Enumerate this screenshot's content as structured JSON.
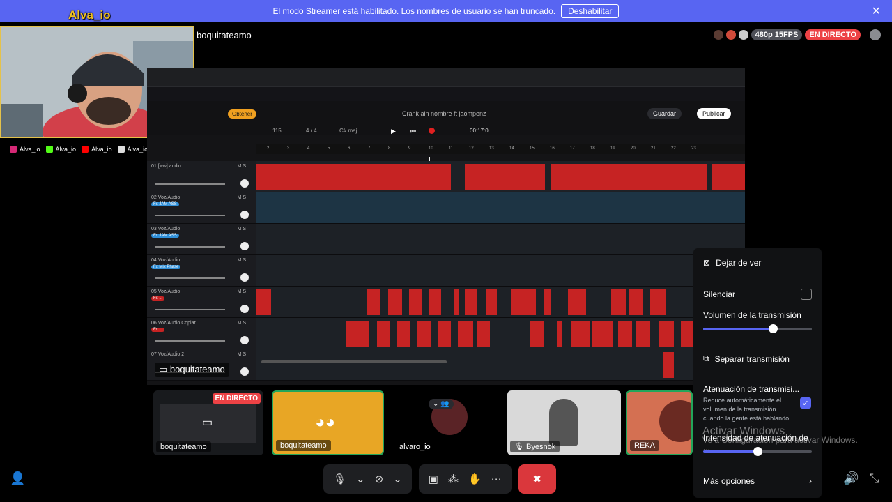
{
  "banner": {
    "message": "El modo Streamer está habilitado. Los nombres de usuario se han truncado.",
    "button": "Deshabilitar",
    "close_icon": "close-icon"
  },
  "overlay": {
    "channel_name": "Alva_io",
    "socials": [
      {
        "icon": "instagram-icon",
        "name": "Alva_io",
        "color": "#d62976"
      },
      {
        "icon": "kick-icon",
        "name": "Alva_io",
        "color": "#53fc18"
      },
      {
        "icon": "youtube-icon",
        "name": "Alva_io",
        "color": "#ff0000"
      },
      {
        "icon": "tiktok-icon",
        "name": "Alva_io",
        "color": "#111111"
      }
    ]
  },
  "stream": {
    "streamer": "boquitateamo",
    "quality": "480p 15FPS",
    "live": "EN DIRECTO",
    "label": "boquitateamo"
  },
  "daw": {
    "song_title": "Crank ain nombre ft jaompenz",
    "save": "Guardar",
    "publish": "Publicar",
    "get_button": "Obtener",
    "time": "00:17:0",
    "bpm": "115",
    "signature": "4 / 4",
    "key": "C# maj",
    "ruler": [
      "2",
      "3",
      "4",
      "5",
      "6",
      "7",
      "8",
      "9",
      "10",
      "11",
      "12",
      "13",
      "14",
      "15",
      "16",
      "17",
      "18",
      "19",
      "20",
      "21",
      "22",
      "23"
    ],
    "tracks": [
      {
        "name": "01 [ww] audio",
        "tag": ""
      },
      {
        "name": "02 Voz/Audio",
        "tag": "Fx JAM ASS"
      },
      {
        "name": "03 Voz/Audio",
        "tag": "Fx JAM ASS"
      },
      {
        "name": "04 Voz/Audio",
        "tag": "Fx Mix Phase"
      },
      {
        "name": "05 Voz/Audio",
        "tag": "Fx ..."
      },
      {
        "name": "06 Voz/Audio Copiar",
        "tag": "Fx ..."
      },
      {
        "name": "07 Voz/Audio 2",
        "tag": ""
      }
    ]
  },
  "participants": [
    {
      "name": "boquitateamo",
      "badge": "EN DIRECTO",
      "icon": "screen-share-icon"
    },
    {
      "name": "boquitateamo",
      "badge": "",
      "icon": "discord-icon"
    },
    {
      "name": "alvaro_io",
      "badge": "",
      "icon": "avatar"
    },
    {
      "name": "Byesnok",
      "badge": "",
      "icon": "mic-muted-icon"
    },
    {
      "name": "REKA",
      "badge": "",
      "icon": "avatar"
    }
  ],
  "menu": {
    "stop_watching": "Dejar de ver",
    "mute": "Silenciar",
    "volume_label": "Volumen de la transmisión",
    "volume_level": 0.64,
    "popout": "Separar transmisión",
    "attenuation_title": "Atenuación de transmisi...",
    "attenuation_desc": "Reduce automáticamente el volumen de la transmisión cuando la gente está hablando.",
    "attenuation_enabled": true,
    "intensity_label": "Intensidad de atenuación de ...",
    "intensity_level": 0.5,
    "more_options": "Más opciones"
  },
  "watermark": {
    "line1": "Activar Windows",
    "line2": "Ve a Configuración para activar Windows."
  },
  "colors": {
    "banner": "#5865f2",
    "live": "#ed4245",
    "accent": "#5865f2",
    "clip": "#c62323"
  }
}
